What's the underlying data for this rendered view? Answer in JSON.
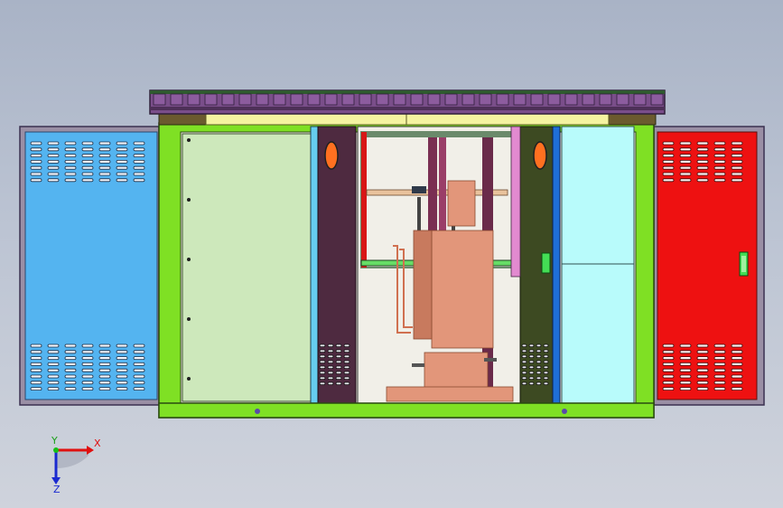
{
  "colors": {
    "roof": "#7a4e8a",
    "roof_dark": "#4e3058",
    "roof_trim": "#2f5a2f",
    "frame_green": "#7fe024",
    "header_yellow": "#f4f3a0",
    "header_brown": "#6b5a2e",
    "left_door": "#54b4f0",
    "right_door": "#ee1111",
    "left_panel": "#cde8bb",
    "right_panel": "#b8fbfb",
    "mid_door_left": "#4e2a40",
    "mid_door_right": "#3d4a22",
    "transformer": "#e2967a",
    "inner_frame": "#6b8a6b",
    "handle_green": "#44dd55",
    "window_orange": "#ff7020",
    "blue_strip": "#1f6fd8"
  },
  "triad": {
    "x_label": "X",
    "y_label": "Y",
    "z_label": "Z"
  }
}
